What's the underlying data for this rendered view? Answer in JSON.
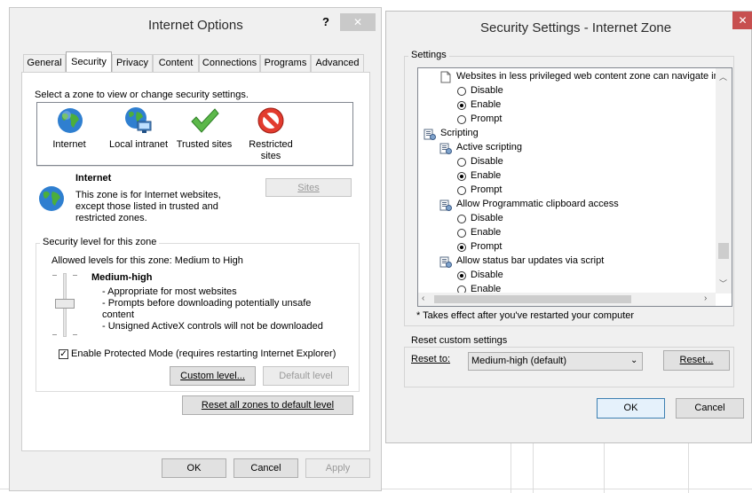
{
  "internet_options": {
    "title": "Internet Options",
    "help_glyph": "?",
    "close_glyph": "✕",
    "tabs": [
      "General",
      "Security",
      "Privacy",
      "Content",
      "Connections",
      "Programs",
      "Advanced"
    ],
    "active_tab": "Security",
    "zone_prompt": "Select a zone to view or change security settings.",
    "zones": [
      {
        "label": "Internet",
        "icon": "globe-icon"
      },
      {
        "label": "Local intranet",
        "icon": "intranet-globe-icon"
      },
      {
        "label": "Trusted sites",
        "icon": "checkmark-icon"
      },
      {
        "label_line1": "Restricted",
        "label_line2": "sites",
        "icon": "restricted-icon"
      }
    ],
    "zone_heading": "Internet",
    "zone_desc_1": "This zone is for Internet websites,",
    "zone_desc_2": "except those listed in trusted and",
    "zone_desc_3": "restricted zones.",
    "sites_button": "Sites",
    "security_level_group": "Security level for this zone",
    "allowed_levels": "Allowed levels for this zone: Medium to High",
    "level_name": "Medium-high",
    "level_bullets": [
      "- Appropriate for most websites",
      "- Prompts before downloading potentially unsafe",
      "content",
      "- Unsigned ActiveX controls will not be downloaded"
    ],
    "protected_mode_checked": true,
    "protected_mode_label": "Enable Protected Mode (requires restarting Internet Explorer)",
    "custom_level_button": "Custom level...",
    "default_level_button": "Default level",
    "reset_all_button": "Reset all zones to default level",
    "ok_button": "OK",
    "cancel_button": "Cancel",
    "apply_button": "Apply"
  },
  "security_settings": {
    "title": "Security Settings - Internet Zone",
    "close_glyph": "✕",
    "settings_group": "Settings",
    "items": [
      {
        "kind": "setting",
        "text": "Websites in less privileged web content zone can navigate in"
      },
      {
        "kind": "option",
        "text": "Disable",
        "checked": false
      },
      {
        "kind": "option",
        "text": "Enable",
        "checked": true
      },
      {
        "kind": "option",
        "text": "Prompt",
        "checked": false
      },
      {
        "kind": "category",
        "text": "Scripting"
      },
      {
        "kind": "setting",
        "text": "Active scripting"
      },
      {
        "kind": "option",
        "text": "Disable",
        "checked": false
      },
      {
        "kind": "option",
        "text": "Enable",
        "checked": true
      },
      {
        "kind": "option",
        "text": "Prompt",
        "checked": false
      },
      {
        "kind": "setting",
        "text": "Allow Programmatic clipboard access"
      },
      {
        "kind": "option",
        "text": "Disable",
        "checked": false
      },
      {
        "kind": "option",
        "text": "Enable",
        "checked": false
      },
      {
        "kind": "option",
        "text": "Prompt",
        "checked": true
      },
      {
        "kind": "setting",
        "text": "Allow status bar updates via script"
      },
      {
        "kind": "option",
        "text": "Disable",
        "checked": true
      },
      {
        "kind": "option",
        "text": "Enable",
        "checked": false
      }
    ],
    "note": "* Takes effect after you've restarted your computer",
    "reset_group": "Reset custom settings",
    "reset_to_label": "Reset to:",
    "reset_to_value": "Medium-high (default)",
    "reset_button": "Reset...",
    "ok_button": "OK",
    "cancel_button": "Cancel"
  },
  "colors": {
    "dialog_bg": "#f0f0f0",
    "close_button": "#c75050",
    "selection_blue": "#3c7fb1"
  }
}
